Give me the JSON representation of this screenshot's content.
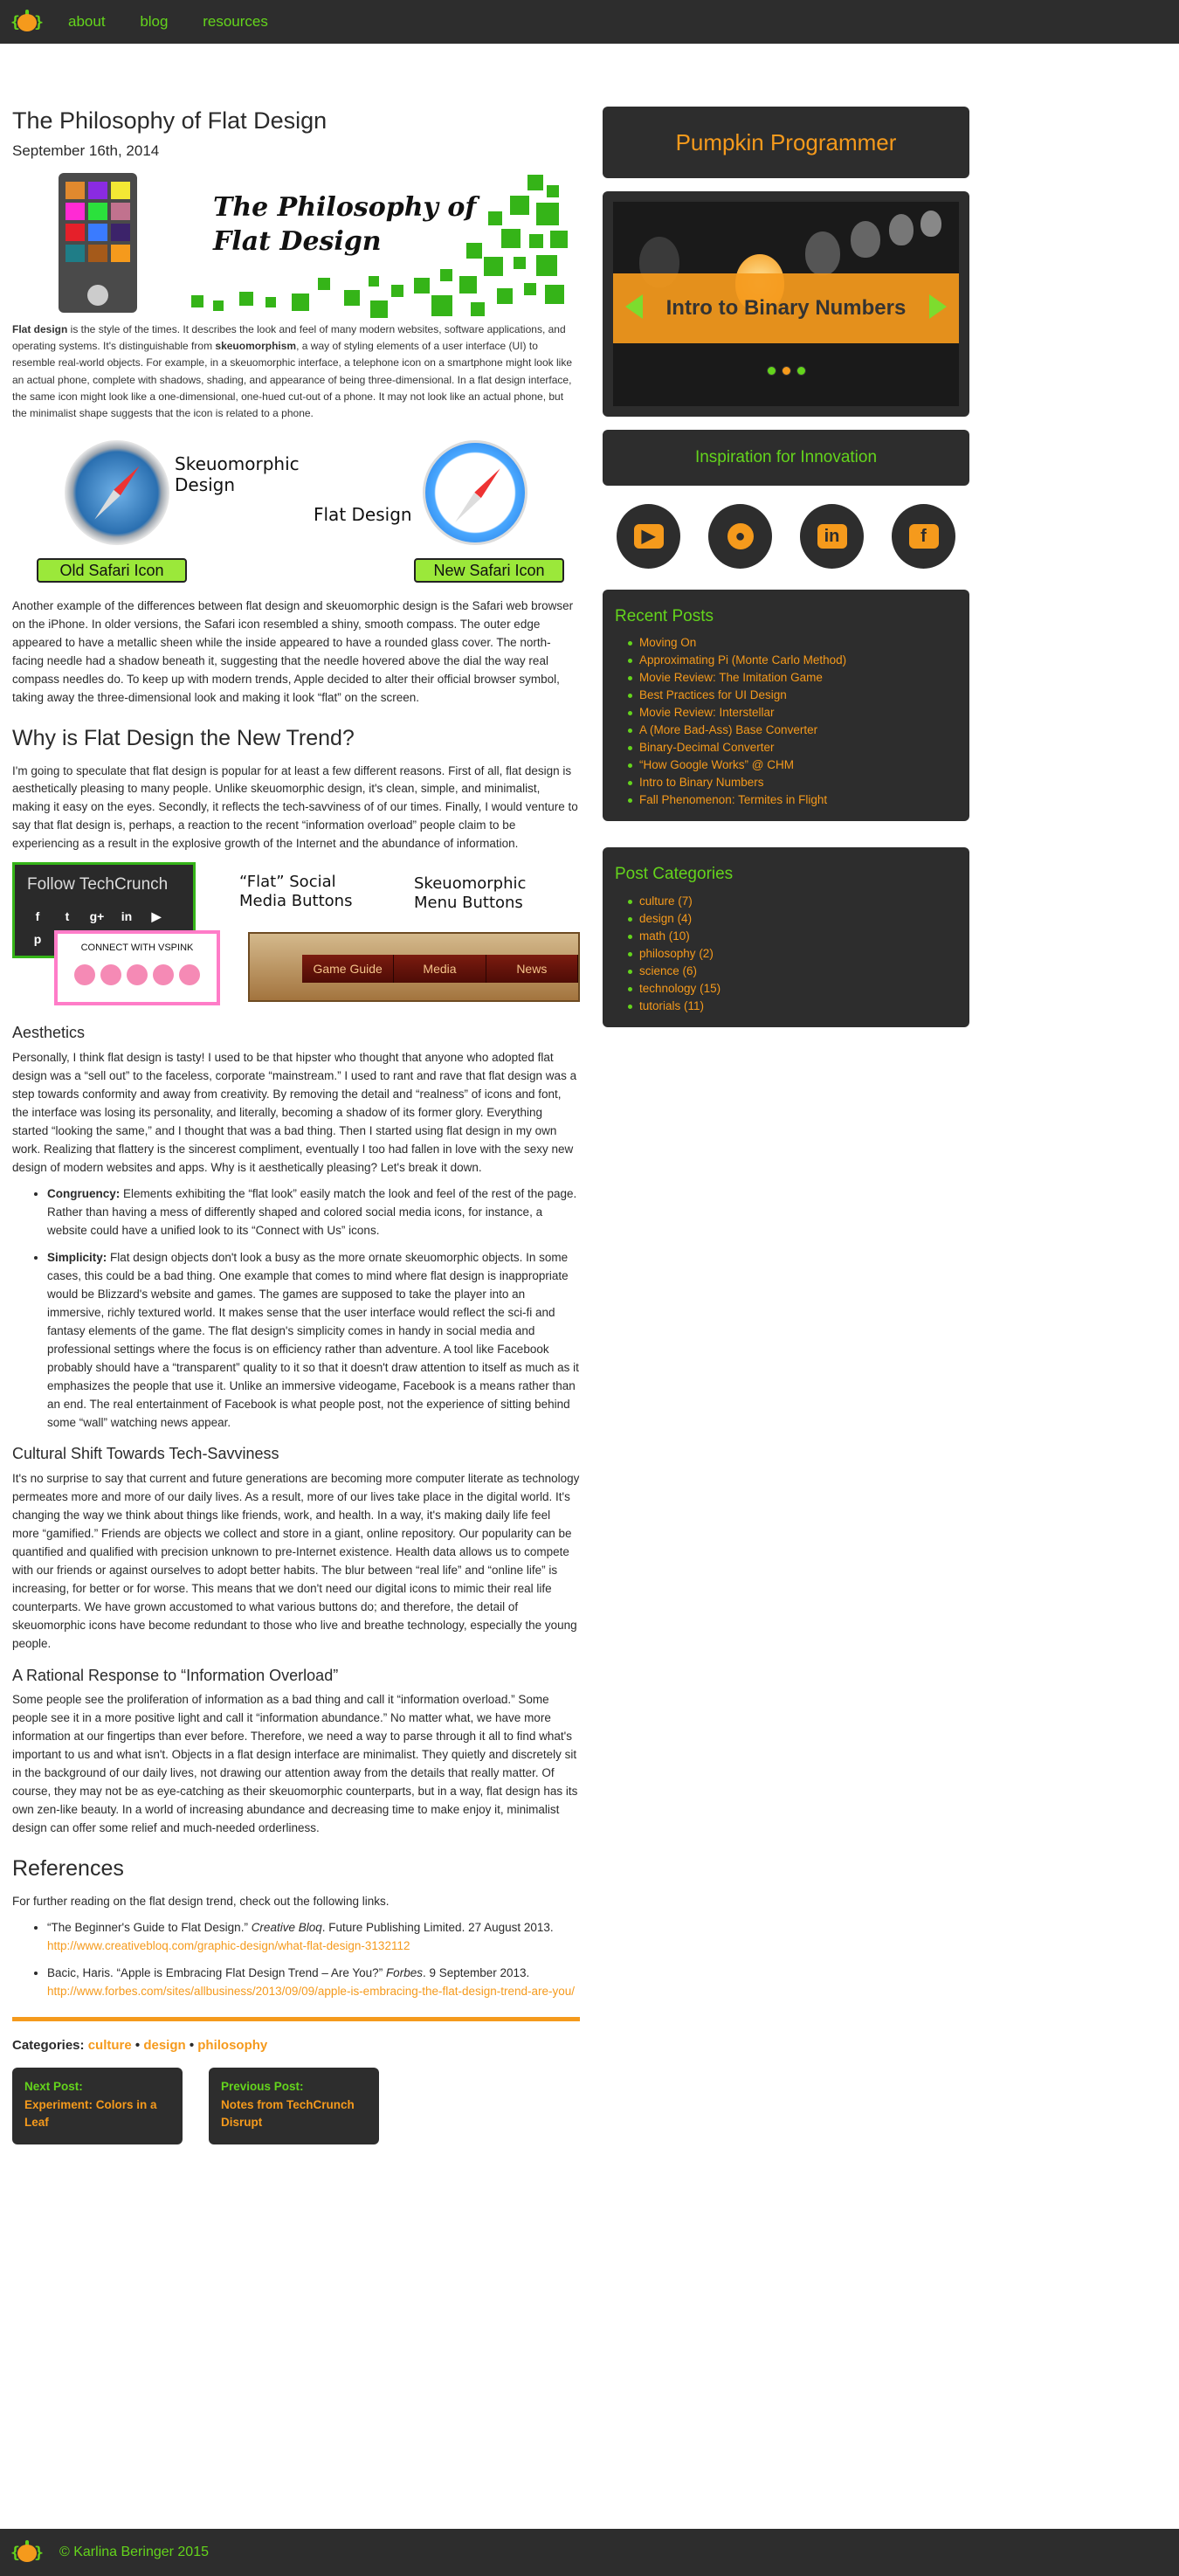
{
  "nav": {
    "links": [
      "about",
      "blog",
      "resources"
    ]
  },
  "post": {
    "title": "The Philosophy of Flat Design",
    "date": "September 16th, 2014",
    "hero_title": "The Philosophy of Flat Design",
    "intro_lead": "Flat design",
    "intro_1": " is the style of the times. It describes the look and feel of many modern websites, software applications, and operating systems. It's distinguishable from ",
    "intro_em": "skeuomorphism",
    "intro_2": ", a way of styling elements of a user interface (UI) to resemble real-world objects. For example, in a skeuomorphic interface, a telephone icon on a smartphone might look like an actual phone, complete with shadows, shading, and appearance of being three-dimensional. In a flat design interface, the same icon might look like a one-dimensional, one-hued cut-out of a phone. It may not look like an actual phone, but the minimalist shape suggests that the icon is related to a phone.",
    "safari_labels": {
      "skeuo": "Skeuomorphic Design",
      "flat": "Flat Design",
      "old": "Old Safari Icon",
      "new": "New Safari Icon"
    },
    "para_safari": "Another example of the differences between flat design and skeuomorphic design is the Safari web browser on the iPhone. In older versions, the Safari icon resembled a shiny, smooth compass. The outer edge appeared to have a metallic sheen while the inside appeared to have a rounded glass cover. The north-facing needle had a shadow beneath it, suggesting that the needle hovered above the dial the way real compass needles do. To keep up with modern trends, Apple decided to alter their official browser symbol, taking away the three-dimensional look and making it look “flat” on the screen.",
    "h_trend": "Why is Flat Design the New Trend?",
    "para_trend": "I'm going to speculate that flat design is popular for at least a few different reasons. First of all, flat design is aesthetically pleasing to many people. Unlike skeuomorphic design, it's clean, simple, and minimalist, making it easy on the eyes. Secondly, it reflects the tech-savviness of of our times. Finally, I would venture to say that flat design is, perhaps, a reaction to the recent “information overload” people claim to be experiencing as a result in the explosive growth of the Internet and the abundance of information.",
    "social_labels": {
      "tc": "Follow TechCrunch",
      "vs": "CONNECT WITH VSPINK",
      "flat": "“Flat” Social Media Buttons",
      "skeuo": "Skeuomorphic Menu Buttons",
      "menu": [
        "Game Guide",
        "Media",
        "News"
      ]
    },
    "h_aesthetics": "Aesthetics",
    "para_aesthetics": "Personally, I think flat design is tasty! I used to be that hipster who thought that anyone who adopted flat design was a “sell out” to the faceless, corporate “mainstream.” I used to rant and rave that flat design was a step towards conformity and away from creativity. By removing the detail and “realness” of icons and font, the interface was losing its personality, and literally, becoming a shadow of its former glory. Everything started “looking the same,” and I thought that was a bad thing. Then I started using flat design in my own work. Realizing that flattery is the sincerest compliment, eventually I too had fallen in love with the sexy new design of modern websites and apps. Why is it aesthetically pleasing? Let's break it down.",
    "bullets": [
      {
        "term": "Congruency:",
        "text": " Elements exhibiting the “flat look” easily match the look and feel of the rest of the page. Rather than having a mess of differently shaped and colored social media icons, for instance, a website could have a unified look to its “Connect with Us” icons."
      },
      {
        "term": "Simplicity:",
        "text": " Flat design objects don't look a busy as the more ornate skeuomorphic objects. In some cases, this could be a bad thing. One example that comes to mind where flat design is inappropriate would be Blizzard's website and games. The games are supposed to take the player into an immersive, richly textured world. It makes sense that the user interface would reflect the sci-fi and fantasy elements of the game. The flat design's simplicity comes in handy in social media and professional settings where the focus is on efficiency rather than adventure. A tool like Facebook probably should have a “transparent” quality to it so that it doesn't draw attention to itself as much as it emphasizes the people that use it. Unlike an immersive videogame, Facebook is a means rather than an end. The real entertainment of Facebook is what people post, not the experience of sitting behind some “wall” watching news appear."
      }
    ],
    "h_cultural": "Cultural Shift Towards Tech-Savviness",
    "para_cultural": "It's no surprise to say that current and future generations are becoming more computer literate as technology permeates more and more of our daily lives. As a result, more of our lives take place in the digital world. It's changing the way we think about things like friends, work, and health. In a way, it's making daily life feel more “gamified.” Friends are objects we collect and store in a giant, online repository. Our popularity can be quantified and qualified with precision unknown to pre-Internet existence. Health data allows us to compete with our friends or against ourselves to adopt better habits. The blur between “real life” and “online life” is increasing, for better or for worse. This means that we don't need our digital icons to mimic their real life counterparts. We have grown accustomed to what various buttons do; and therefore, the detail of skeuomorphic icons have become redundant to those who live and breathe technology, especially the young people.",
    "h_rational": "A Rational Response to “Information Overload”",
    "para_rational": "Some people see the proliferation of information as a bad thing and call it “information overload.” Some people see it in a more positive light and call it “information abundance.” No matter what, we have more information at our fingertips than ever before. Therefore, we need a way to parse through it all to find what's important to us and what isn't. Objects in a flat design interface are minimalist. They quietly and discretely sit in the background of our daily lives, not drawing our attention away from the details that really matter. Of course, they may not be as eye-catching as their skeuomorphic counterparts, but in a way, flat design has its own zen-like beauty. In a world of increasing abundance and decreasing time to make enjoy it, minimalist design can offer some relief and much-needed orderliness.",
    "h_refs": "References",
    "refs_intro": "For further reading on the flat design trend, check out the following links.",
    "refs": [
      {
        "pre": "“The Beginner's Guide to Flat Design.” ",
        "em": "Creative Bloq",
        "post": ". Future Publishing Limited. 27 August 2013.",
        "url": "http://www.creativebloq.com/graphic-design/what-flat-design-3132112"
      },
      {
        "pre": "Bacic, Haris. “Apple is Embracing Flat Design Trend – Are You?” ",
        "em": "Forbes",
        "post": ". 9 September 2013.",
        "url": "http://www.forbes.com/sites/allbusiness/2013/09/09/apple-is-embracing-the-flat-design-trend-are-you/"
      }
    ],
    "categories_label": "Categories:",
    "categories": [
      "culture",
      "design",
      "philosophy"
    ],
    "next": {
      "label": "Next Post:",
      "title": "Experiment: Colors in a Leaf"
    },
    "prev": {
      "label": "Previous Post:",
      "title": "Notes from TechCrunch Disrupt"
    }
  },
  "sidebar": {
    "brand": "Pumpkin Programmer",
    "slide_title": "Intro to Binary Numbers",
    "inspiration": "Inspiration for Innovation",
    "social_icons": [
      "youtube-icon",
      "github-icon",
      "linkedin-icon",
      "facebook-icon"
    ],
    "recent_title": "Recent Posts",
    "recent": [
      "Moving On",
      "Approximating Pi (Monte Carlo Method)",
      "Movie Review: The Imitation Game",
      "Best Practices for UI Design",
      "Movie Review: Interstellar",
      "A (More Bad-Ass) Base Converter",
      "Binary-Decimal Converter",
      "“How Google Works” @ CHM",
      "Intro to Binary Numbers",
      "Fall Phenomenon: Termites in Flight"
    ],
    "categories_title": "Post Categories",
    "categories": [
      {
        "name": "culture",
        "count": "(7)"
      },
      {
        "name": "design",
        "count": "(4)"
      },
      {
        "name": "math",
        "count": "(10)"
      },
      {
        "name": "philosophy",
        "count": "(2)"
      },
      {
        "name": "science",
        "count": "(6)"
      },
      {
        "name": "technology",
        "count": "(15)"
      },
      {
        "name": "tutorials",
        "count": "(11)"
      }
    ]
  },
  "footer": {
    "copyright": "© Karlina Beringer 2015"
  },
  "colors": {
    "accent": "#f59a1c",
    "green": "#64d41c",
    "dark": "#2d2d2d"
  }
}
